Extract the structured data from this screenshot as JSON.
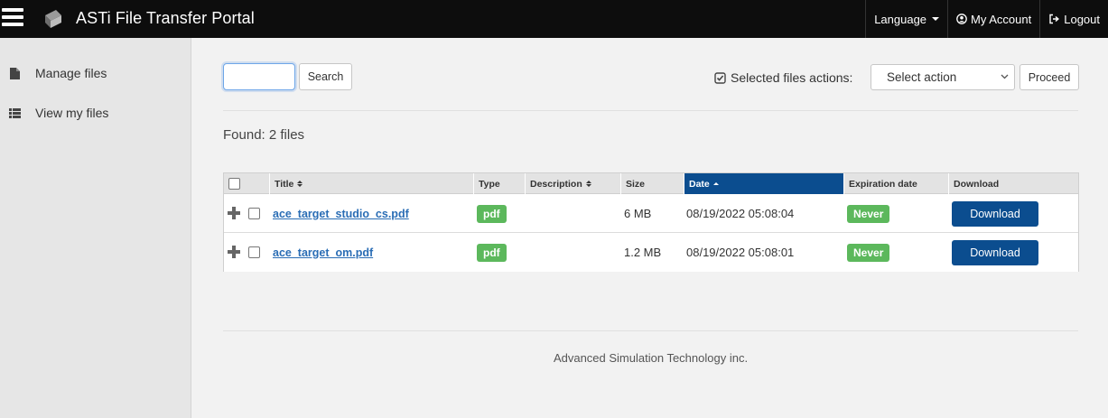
{
  "app": {
    "title": "ASTi File Transfer Portal"
  },
  "nav": {
    "language": "Language",
    "my_account": "My Account",
    "logout": "Logout"
  },
  "sidebar": {
    "items": [
      {
        "label": "Manage files",
        "icon": "file-icon"
      },
      {
        "label": "View my files",
        "icon": "list-icon"
      }
    ]
  },
  "toolbar": {
    "search_value": "",
    "search_button": "Search",
    "selected_files_actions": "Selected files actions:",
    "action_select": "Select action",
    "proceed": "Proceed"
  },
  "results": {
    "found": "Found: 2 files"
  },
  "table": {
    "columns": {
      "title": "Title",
      "type": "Type",
      "description": "Description",
      "size": "Size",
      "date": "Date",
      "expiration": "Expiration date",
      "download": "Download"
    },
    "sorted_by": "Date",
    "rows": [
      {
        "title": "ace_target_studio_cs.pdf",
        "type": "pdf",
        "description": "",
        "size": "6 MB",
        "date": "08/19/2022 05:08:04",
        "expiration": "Never",
        "download": "Download"
      },
      {
        "title": "ace_target_om.pdf",
        "type": "pdf",
        "description": "",
        "size": "1.2 MB",
        "date": "08/19/2022 05:08:01",
        "expiration": "Never",
        "download": "Download"
      }
    ]
  },
  "footer": {
    "text": "Advanced Simulation Technology inc."
  },
  "colors": {
    "navbar": "#0d0d0d",
    "primary": "#0b4d8f",
    "success": "#5cb85c",
    "link": "#2a6db5"
  }
}
